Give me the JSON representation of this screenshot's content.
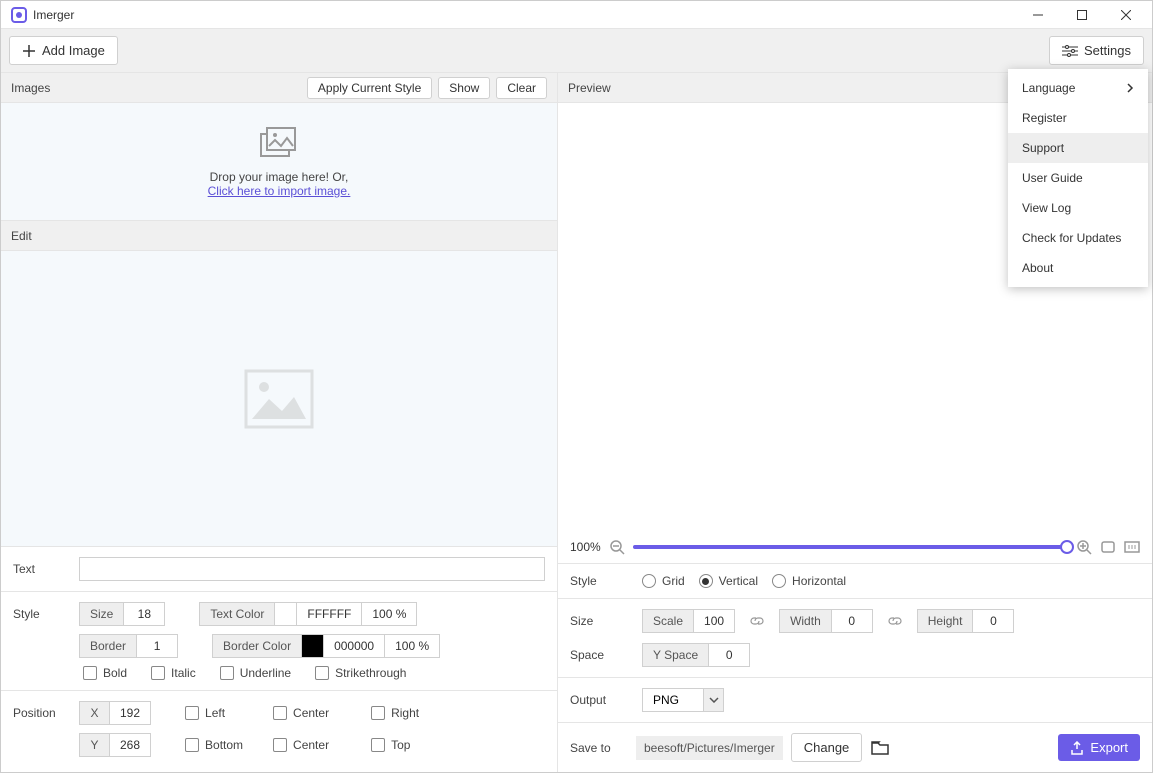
{
  "app": {
    "title": "Imerger"
  },
  "toolbar": {
    "add_image": "Add Image",
    "settings": "Settings"
  },
  "settings_menu": {
    "language": "Language",
    "register": "Register",
    "support": "Support",
    "user_guide": "User Guide",
    "view_log": "View Log",
    "check_updates": "Check for Updates",
    "about": "About"
  },
  "images": {
    "header": "Images",
    "apply_style": "Apply Current Style",
    "show": "Show",
    "clear": "Clear",
    "drop_msg": "Drop your image here! Or,",
    "import_link": "Click here to import image."
  },
  "edit": {
    "header": "Edit"
  },
  "text_section": {
    "label": "Text",
    "value": ""
  },
  "style_section": {
    "label": "Style",
    "size_label": "Size",
    "size_value": "18",
    "text_color_label": "Text Color",
    "text_color_hex": "FFFFFF",
    "text_color_pct": "100 %",
    "border_label": "Border",
    "border_value": "1",
    "border_color_label": "Border Color",
    "border_color_hex": "000000",
    "border_color_pct": "100 %",
    "bold": "Bold",
    "italic": "Italic",
    "underline": "Underline",
    "strikethrough": "Strikethrough"
  },
  "position_section": {
    "label": "Position",
    "x_label": "X",
    "x_value": "192",
    "y_label": "Y",
    "y_value": "268",
    "left": "Left",
    "center": "Center",
    "right": "Right",
    "bottom": "Bottom",
    "top": "Top"
  },
  "preview": {
    "header": "Preview",
    "zoom": "100%"
  },
  "right_style": {
    "label": "Style",
    "grid": "Grid",
    "vertical": "Vertical",
    "horizontal": "Horizontal"
  },
  "right_size": {
    "label": "Size",
    "scale_label": "Scale",
    "scale_value": "100",
    "width_label": "Width",
    "width_value": "0",
    "height_label": "Height",
    "height_value": "0",
    "space_label": "Space",
    "yspace_label": "Y Space",
    "yspace_value": "0"
  },
  "output": {
    "label": "Output",
    "format": "PNG"
  },
  "save": {
    "label": "Save to",
    "path": "beesoft/Pictures/Imerger",
    "change": "Change",
    "export": "Export"
  }
}
